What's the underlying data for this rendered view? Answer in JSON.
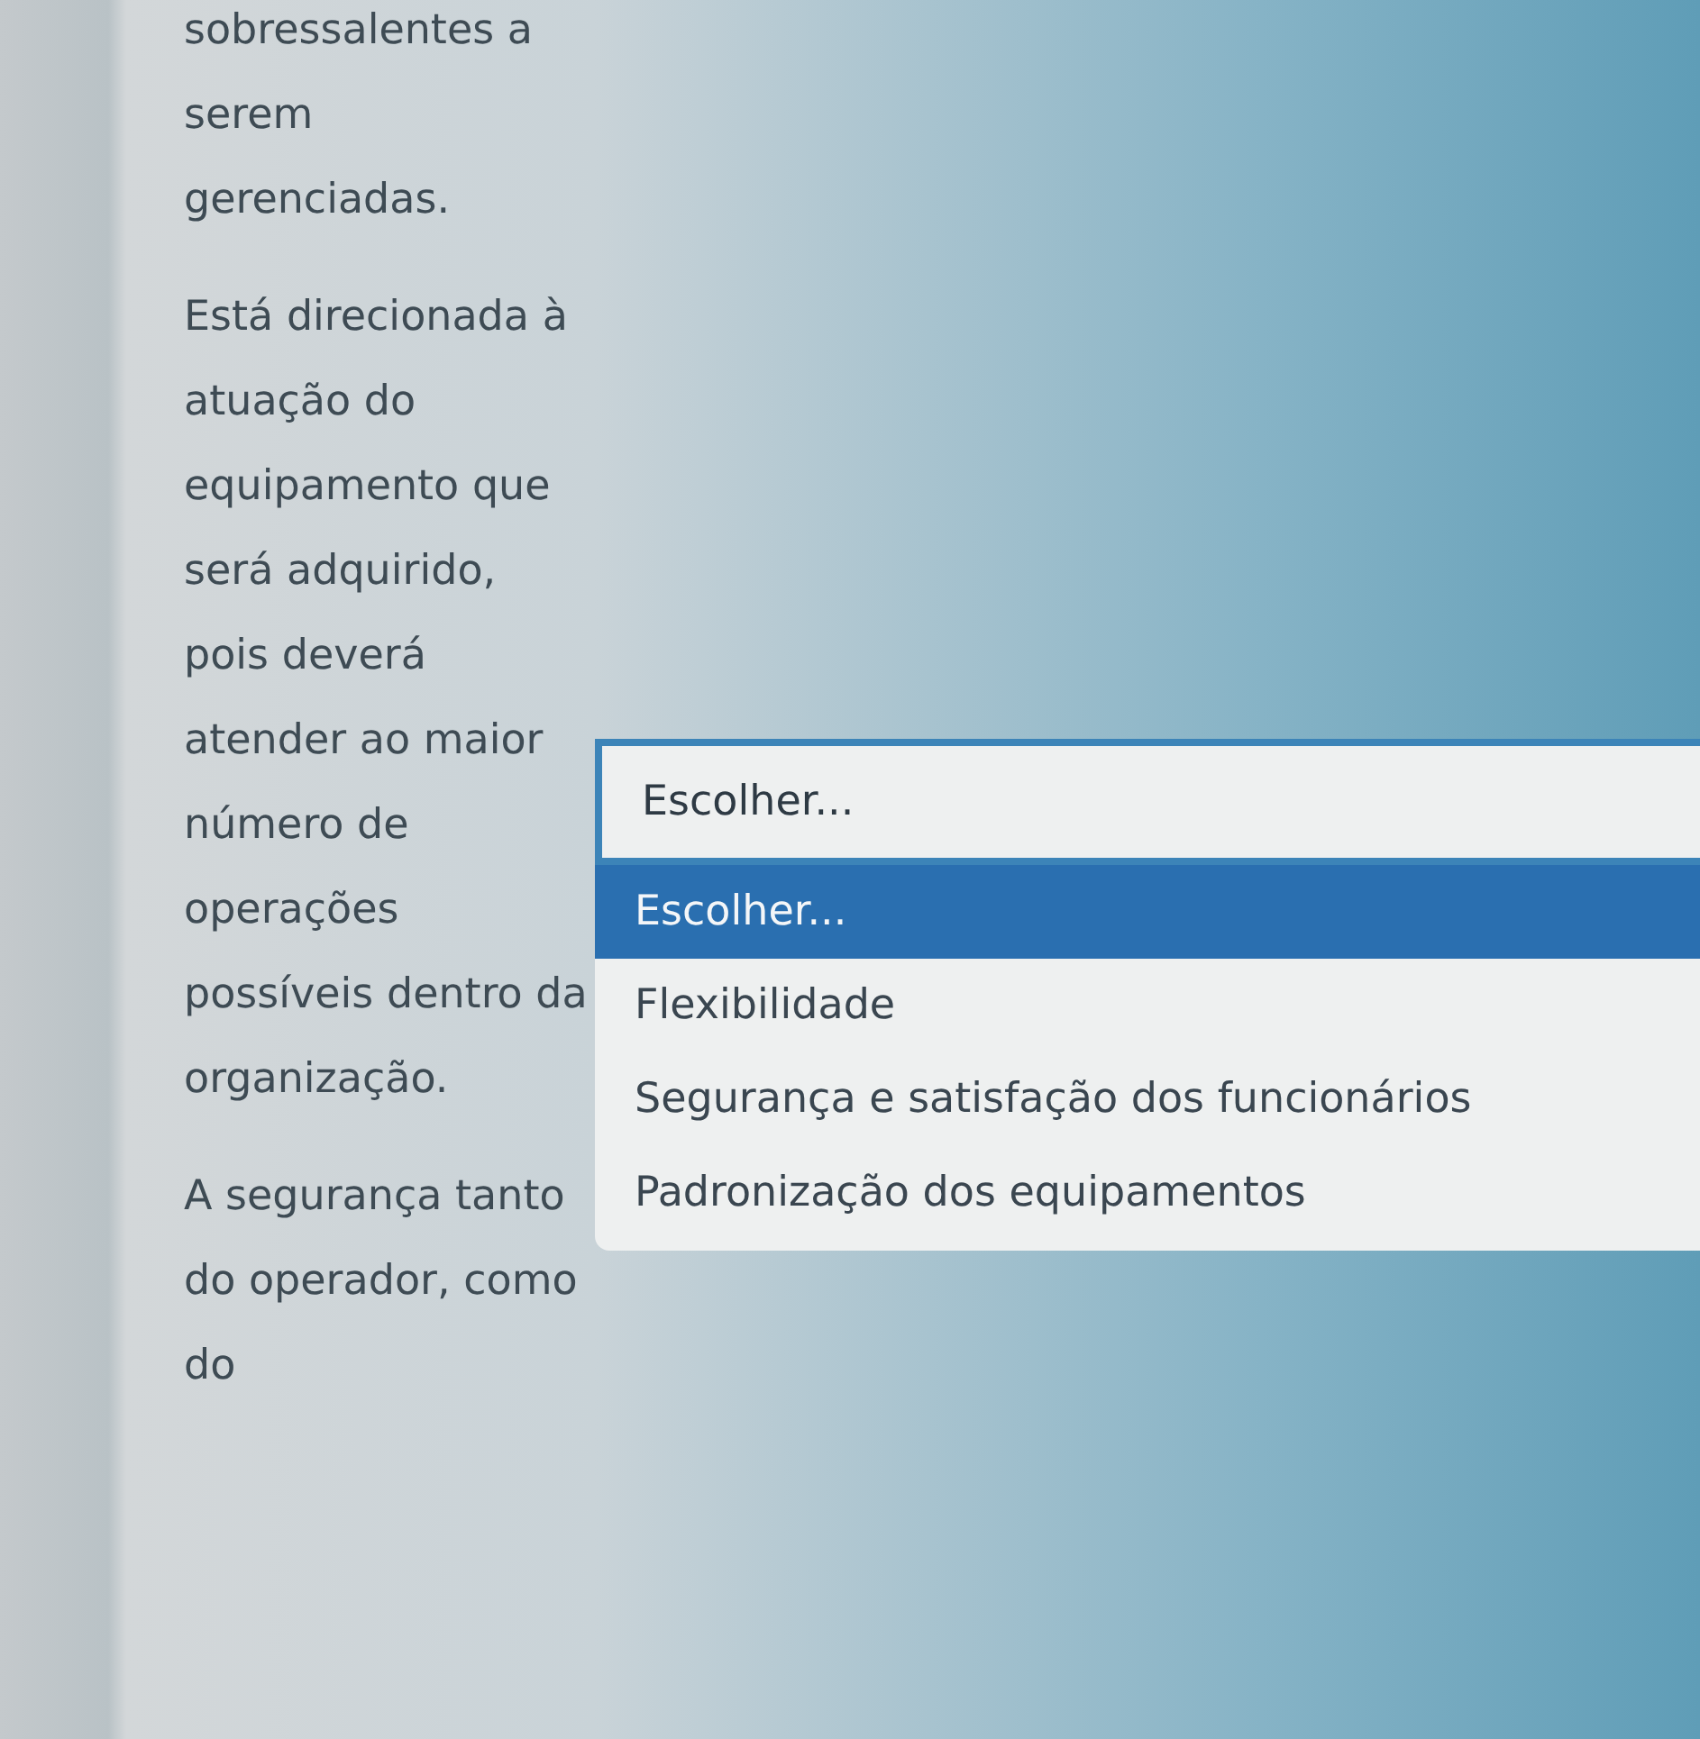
{
  "paragraphs": [
    "sobressalentes a serem gerenciadas.",
    "Está direcionada à atuação do equipamento que será adquirido, pois deverá atender ao maior número de operações possíveis dentro da organização.",
    "A segurança tanto do operador, como do"
  ],
  "select": {
    "value": "Escolher...",
    "options": [
      {
        "label": "Escolher...",
        "selected": true
      },
      {
        "label": "Flexibilidade",
        "selected": false
      },
      {
        "label": "Segurança e satisfação dos funcionários",
        "selected": false
      },
      {
        "label": "Padronização dos equipamentos",
        "selected": false
      }
    ]
  }
}
